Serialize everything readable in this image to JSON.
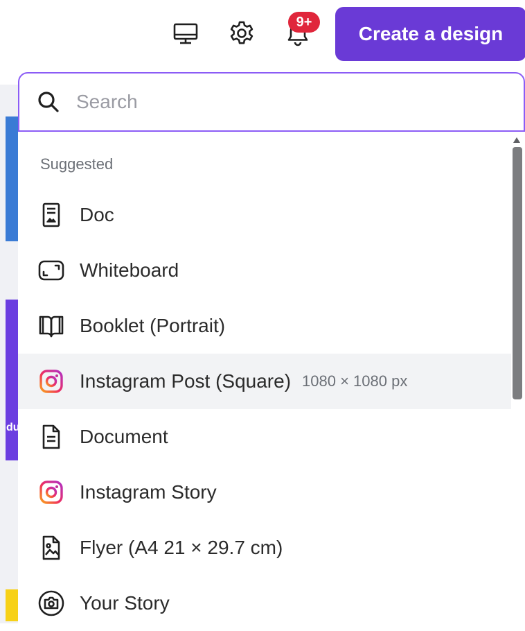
{
  "topbar": {
    "icons": [
      "desktop-icon",
      "gear-icon",
      "bell-icon"
    ],
    "notifications_badge": "9+",
    "create_button_label": "Create a design"
  },
  "search": {
    "placeholder": "Search",
    "value": ""
  },
  "dropdown": {
    "section_label": "Suggested",
    "items": [
      {
        "label": "Doc",
        "icon": "doc-icon"
      },
      {
        "label": "Whiteboard",
        "icon": "whiteboard-icon"
      },
      {
        "label": "Booklet (Portrait)",
        "icon": "booklet-icon"
      },
      {
        "label": "Instagram Post (Square)",
        "size": "1080 × 1080 px",
        "icon": "instagram-icon",
        "highlighted": true
      },
      {
        "label": "Document",
        "icon": "document-icon"
      },
      {
        "label": "Instagram Story",
        "icon": "instagram-icon"
      },
      {
        "label": "Flyer (A4 21 × 29.7 cm)",
        "icon": "flyer-icon"
      },
      {
        "label": "Your Story",
        "icon": "camera-icon"
      }
    ]
  },
  "background": {
    "partial_text": "du"
  },
  "colors": {
    "accent": "#6a3ad6",
    "search_border": "#8b5cf6",
    "badge": "#e0263b",
    "highlight_row": "#f2f3f5"
  }
}
